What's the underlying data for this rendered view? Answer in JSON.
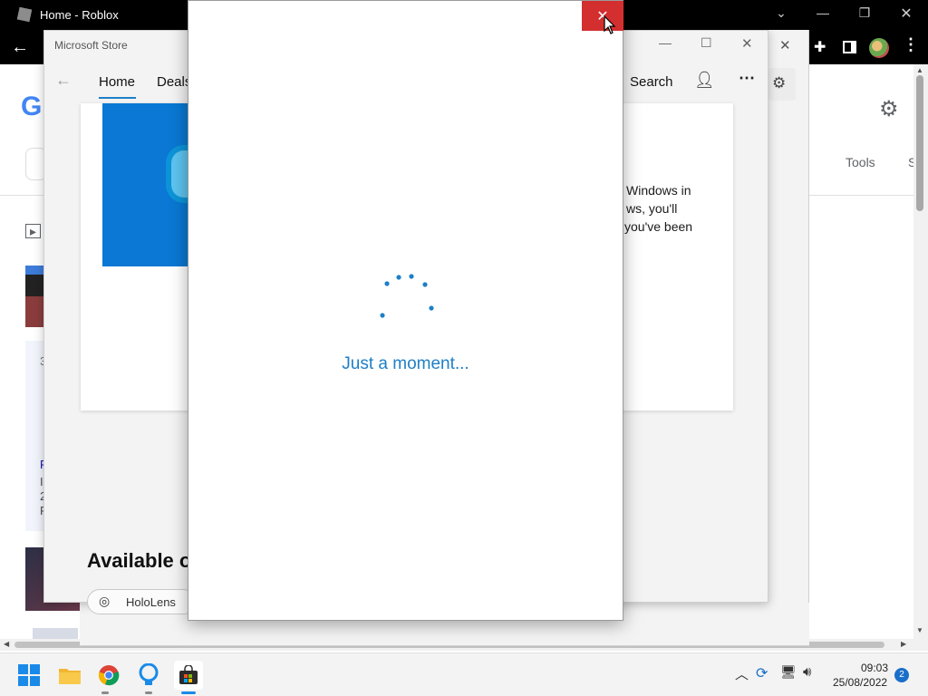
{
  "chrome": {
    "tab_title": "Home - Roblox",
    "google_letter": "G",
    "tools_label": "Tools",
    "partial_nav_letter": "S",
    "partial_letters": [
      "3",
      "F",
      "I",
      "2",
      "F"
    ]
  },
  "store": {
    "title": "Microsoft Store",
    "tabs": [
      "Home",
      "Deals"
    ],
    "search_label": "Search",
    "description_lines": [
      "Windows in",
      "ws, you'll",
      "you've been"
    ],
    "available_heading": "Available o",
    "chip_label": "HoloLens"
  },
  "dialog": {
    "message": "Just a moment..."
  },
  "taskbar": {
    "time": "09:03",
    "date": "25/08/2022",
    "notification_count": "2"
  },
  "colors": {
    "accent_blue": "#1e7fc7",
    "close_red": "#d32f2f",
    "store_blue_tile": "#0a78d4",
    "chrome_dark": "#000000"
  }
}
